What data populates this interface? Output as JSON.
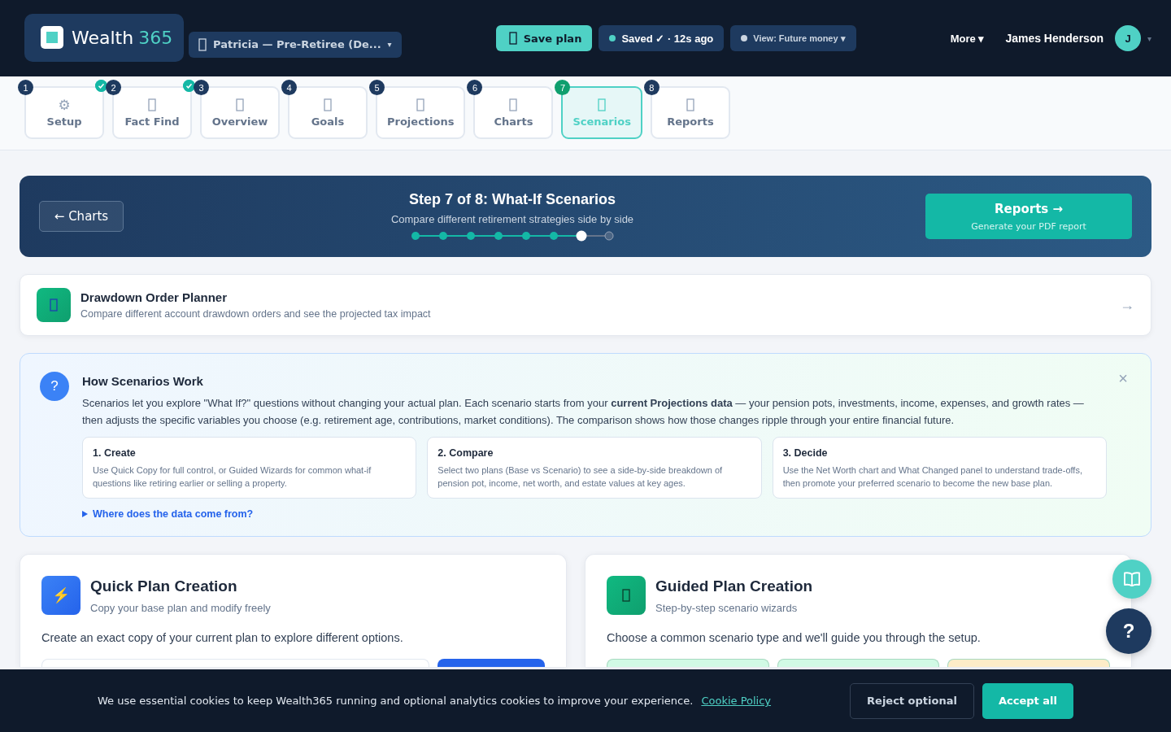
{
  "header": {
    "logo": {
      "word": "Wealth",
      "number": "365"
    },
    "client": {
      "label": "Patricia — Pre-Retiree (De...",
      "caret": "▾"
    },
    "save_button": "Save plan",
    "saved_status": "Saved ✓ · 12s ago",
    "view_selector": "View: Future money ▾",
    "more_menu": "More ▾",
    "user": {
      "name": "James Henderson",
      "initial": "J",
      "caret": "▾"
    }
  },
  "steps": [
    {
      "number": "1",
      "label": "Setup",
      "icon": "⚙",
      "done": true,
      "selected": false
    },
    {
      "number": "2",
      "label": "Fact Find",
      "done": true,
      "selected": false
    },
    {
      "number": "3",
      "label": "Overview",
      "done": false,
      "selected": false
    },
    {
      "number": "4",
      "label": "Goals",
      "done": false,
      "selected": false
    },
    {
      "number": "5",
      "label": "Projections",
      "done": false,
      "selected": false
    },
    {
      "number": "6",
      "label": "Charts",
      "done": false,
      "selected": false
    },
    {
      "number": "7",
      "label": "Scenarios",
      "done": false,
      "selected": true
    },
    {
      "number": "8",
      "label": "Reports",
      "done": false,
      "selected": false
    }
  ],
  "banner": {
    "back_button": "← Charts",
    "title": "Step 7 of 8: What-If Scenarios",
    "subtitle": "Compare different retirement strategies side by side",
    "progress": [
      {
        "reached": true,
        "selected": false
      },
      {
        "reached": true,
        "selected": false
      },
      {
        "reached": true,
        "selected": false
      },
      {
        "reached": true,
        "selected": false
      },
      {
        "reached": true,
        "selected": false
      },
      {
        "reached": true,
        "selected": false
      },
      {
        "reached": true,
        "selected": true
      },
      {
        "reached": false,
        "selected": false
      }
    ],
    "next_button": {
      "title": "Reports →",
      "subtitle": "Generate your PDF report"
    }
  },
  "planner_card": {
    "title": "Drawdown Order Planner",
    "description": "Compare different account drawdown orders and see the projected tax impact",
    "arrow": "→"
  },
  "how_it_works": {
    "icon": "?",
    "title": "How Scenarios Work",
    "close": "×",
    "text": "Scenarios let you explore \"What If?\" questions without changing your actual plan. Each scenario starts from your **current Projections data** — your pension pots, investments, income, expenses, and growth rates — then adjusts the specific variables you choose (e.g. retirement age, contributions, market conditions). The comparison shows how those changes ripple through your entire financial future.",
    "cards": [
      {
        "title": "1. Create",
        "text": "Use Quick Copy for full control, or Guided Wizards for common what-if questions like retiring earlier or selling a property."
      },
      {
        "title": "2. Compare",
        "text": "Select two plans (Base vs Scenario) to see a side-by-side breakdown of pension pot, income, net worth, and estate values at key ages."
      },
      {
        "title": "3. Decide",
        "text": "Use the Net Worth chart and What Changed panel to understand trade-offs, then promote your preferred scenario to become the new base plan."
      }
    ],
    "disclosure": "Where does the data come from?",
    "expanded": false
  },
  "creation_cards": [
    {
      "kind": "quick",
      "icon": "⚡",
      "title": "Quick Plan Creation",
      "subtitle": "Copy your base plan and modify freely",
      "description": "Create an exact copy of your current plan to explore different options."
    },
    {
      "kind": "guided",
      "title": "Guided Plan Creation",
      "subtitle": "Step-by-step scenario wizards",
      "description": "Choose a common scenario type and we'll guide you through the setup.",
      "tiles": [
        {
          "color": "#d1fae5"
        },
        {
          "color": "#d1fae5"
        },
        {
          "color": "#fdecc8"
        }
      ]
    }
  ],
  "help_buttons": {
    "help": "?"
  },
  "cookie_bar": {
    "text": "We use essential cookies to keep Wealth365 running and optional analytics cookies to improve your experience.",
    "link": "Cookie Policy",
    "reject": "Reject optional",
    "accept": "Accept all"
  }
}
